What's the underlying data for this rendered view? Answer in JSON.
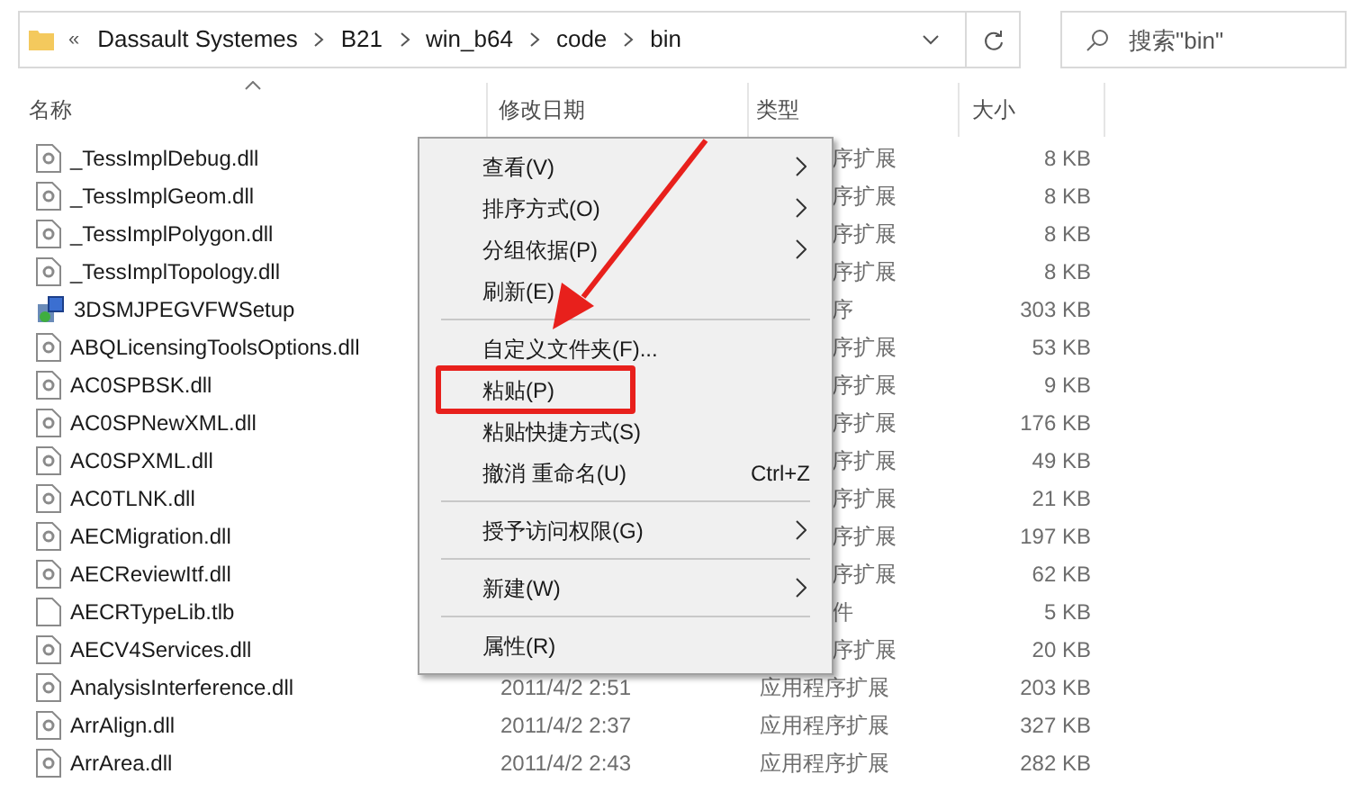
{
  "address_bar": {
    "overflow": "«",
    "crumbs": [
      "Dassault Systemes",
      "B21",
      "win_b64",
      "code",
      "bin"
    ]
  },
  "search": {
    "placeholder": "搜索\"bin\""
  },
  "columns": [
    "名称",
    "修改日期",
    "类型",
    "大小"
  ],
  "rows": [
    {
      "name": "_TessImplDebug.dll",
      "kind": "dll",
      "type": "序扩展",
      "size": "8 KB"
    },
    {
      "name": "_TessImplGeom.dll",
      "kind": "dll",
      "type": "序扩展",
      "size": "8 KB"
    },
    {
      "name": "_TessImplPolygon.dll",
      "kind": "dll",
      "type": "序扩展",
      "size": "8 KB"
    },
    {
      "name": "_TessImplTopology.dll",
      "kind": "dll",
      "type": "序扩展",
      "size": "8 KB"
    },
    {
      "name": "3DSMJPEGVFWSetup",
      "kind": "exe",
      "type": "序",
      "size": "303 KB"
    },
    {
      "name": "ABQLicensingToolsOptions.dll",
      "kind": "dll",
      "type": "序扩展",
      "size": "53 KB"
    },
    {
      "name": "AC0SPBSK.dll",
      "kind": "dll",
      "type": "序扩展",
      "size": "9 KB"
    },
    {
      "name": "AC0SPNewXML.dll",
      "kind": "dll",
      "type": "序扩展",
      "size": "176 KB"
    },
    {
      "name": "AC0SPXML.dll",
      "kind": "dll",
      "type": "序扩展",
      "size": "49 KB"
    },
    {
      "name": "AC0TLNK.dll",
      "kind": "dll",
      "type": "序扩展",
      "size": "21 KB"
    },
    {
      "name": "AECMigration.dll",
      "kind": "dll",
      "type": "序扩展",
      "size": "197 KB"
    },
    {
      "name": "AECReviewItf.dll",
      "kind": "dll",
      "type": "序扩展",
      "size": "62 KB"
    },
    {
      "name": "AECRTypeLib.tlb",
      "kind": "file",
      "type": "件",
      "size": "5 KB"
    },
    {
      "name": "AECV4Services.dll",
      "kind": "dll",
      "type": "序扩展",
      "size": "20 KB"
    },
    {
      "name": "AnalysisInterference.dll",
      "kind": "dll",
      "date": "2011/4/2 2:51",
      "type": "应用程序扩展",
      "size": "203 KB"
    },
    {
      "name": "ArrAlign.dll",
      "kind": "dll",
      "date": "2011/4/2 2:37",
      "type": "应用程序扩展",
      "size": "327 KB"
    },
    {
      "name": "ArrArea.dll",
      "kind": "dll",
      "date": "2011/4/2 2:43",
      "type": "应用程序扩展",
      "size": "282 KB"
    }
  ],
  "context_menu": [
    {
      "kind": "item",
      "label": "查看(V)",
      "submenu": true,
      "highlighted": false
    },
    {
      "kind": "item",
      "label": "排序方式(O)",
      "submenu": true,
      "highlighted": false
    },
    {
      "kind": "item",
      "label": "分组依据(P)",
      "submenu": true,
      "highlighted": false
    },
    {
      "kind": "item",
      "label": "刷新(E)",
      "submenu": false,
      "highlighted": false
    },
    {
      "kind": "separator"
    },
    {
      "kind": "item",
      "label": "自定义文件夹(F)...",
      "submenu": false,
      "highlighted": false
    },
    {
      "kind": "item",
      "label": "粘贴(P)",
      "submenu": false,
      "highlighted": true
    },
    {
      "kind": "item",
      "label": "粘贴快捷方式(S)",
      "submenu": false,
      "highlighted": false
    },
    {
      "kind": "item",
      "label": "撤消 重命名(U)",
      "shortcut": "Ctrl+Z",
      "submenu": false,
      "highlighted": false
    },
    {
      "kind": "separator"
    },
    {
      "kind": "item",
      "label": "授予访问权限(G)",
      "submenu": true,
      "highlighted": false
    },
    {
      "kind": "separator"
    },
    {
      "kind": "item",
      "label": "新建(W)",
      "submenu": true,
      "highlighted": false
    },
    {
      "kind": "separator"
    },
    {
      "kind": "item",
      "label": "属性(R)",
      "submenu": false,
      "highlighted": false
    }
  ]
}
